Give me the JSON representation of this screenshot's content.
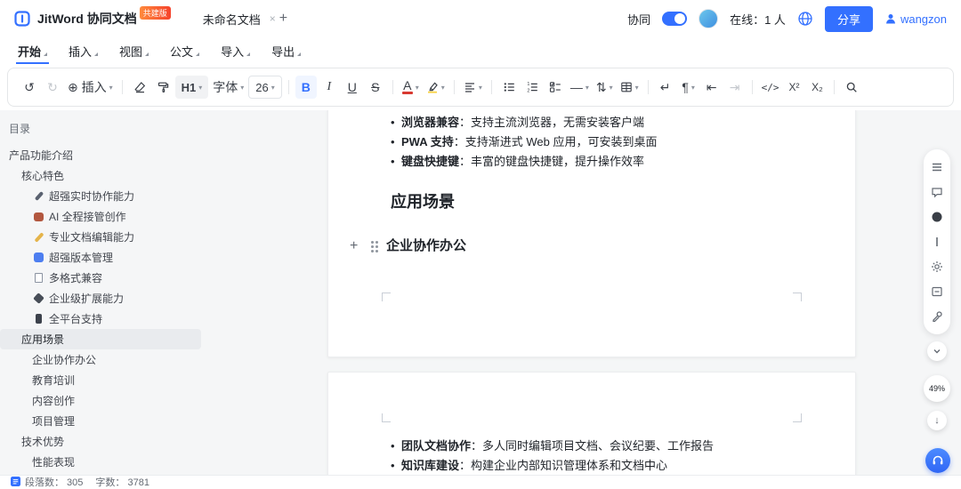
{
  "header": {
    "app_title": "JitWord 协同文档",
    "badge": "共建版",
    "doc_tab": "未命名文档",
    "collab_label": "协同",
    "online_status": "在线：1 人",
    "share_button": "分享",
    "username": "wangzon"
  },
  "menu": {
    "items": [
      {
        "label": "开始"
      },
      {
        "label": "插入"
      },
      {
        "label": "视图"
      },
      {
        "label": "公文"
      },
      {
        "label": "导入"
      },
      {
        "label": "导出"
      }
    ]
  },
  "toolbar": {
    "insert_label": "插入",
    "heading_label": "H1",
    "font_label": "字体",
    "font_size": "26",
    "bold_label": "B",
    "italic_label": "I",
    "underline_label": "U",
    "strike_label": "S",
    "color_label": "A",
    "code_label": "</>",
    "sup_label": "X²",
    "sub_label": "X₂"
  },
  "sidebar": {
    "title": "目录",
    "items": [
      {
        "label": "产品功能介绍"
      },
      {
        "label": "核心特色"
      },
      {
        "label": "超强实时协作能力"
      },
      {
        "label": "AI 全程接管创作"
      },
      {
        "label": "专业文档编辑能力"
      },
      {
        "label": "超强版本管理"
      },
      {
        "label": "多格式兼容"
      },
      {
        "label": "企业级扩展能力"
      },
      {
        "label": "全平台支持"
      },
      {
        "label": "应用场景"
      },
      {
        "label": "企业协作办公"
      },
      {
        "label": "教育培训"
      },
      {
        "label": "内容创作"
      },
      {
        "label": "项目管理"
      },
      {
        "label": "技术优势"
      },
      {
        "label": "性能表现"
      }
    ]
  },
  "document": {
    "page1": {
      "bullets": [
        {
          "term": "浏览器兼容",
          "desc": "：支持主流浏览器，无需安装客户端"
        },
        {
          "term": "PWA 支持",
          "desc": "：支持渐进式 Web 应用，可安装到桌面"
        },
        {
          "term": "键盘快捷键",
          "desc": "：丰富的键盘快捷键，提升操作效率"
        }
      ],
      "heading": "应用场景",
      "subheading": "企业协作办公"
    },
    "page2": {
      "bullets": [
        {
          "term": "团队文档协作",
          "desc": "：多人同时编辑项目文档、会议纪要、工作报告"
        },
        {
          "term": "知识库建设",
          "desc": "：构建企业内部知识管理体系和文档中心"
        }
      ]
    }
  },
  "right_panel": {
    "zoom": "49%"
  },
  "status_bar": {
    "paragraphs": "段落数： 305",
    "words": "字数： 3781"
  }
}
